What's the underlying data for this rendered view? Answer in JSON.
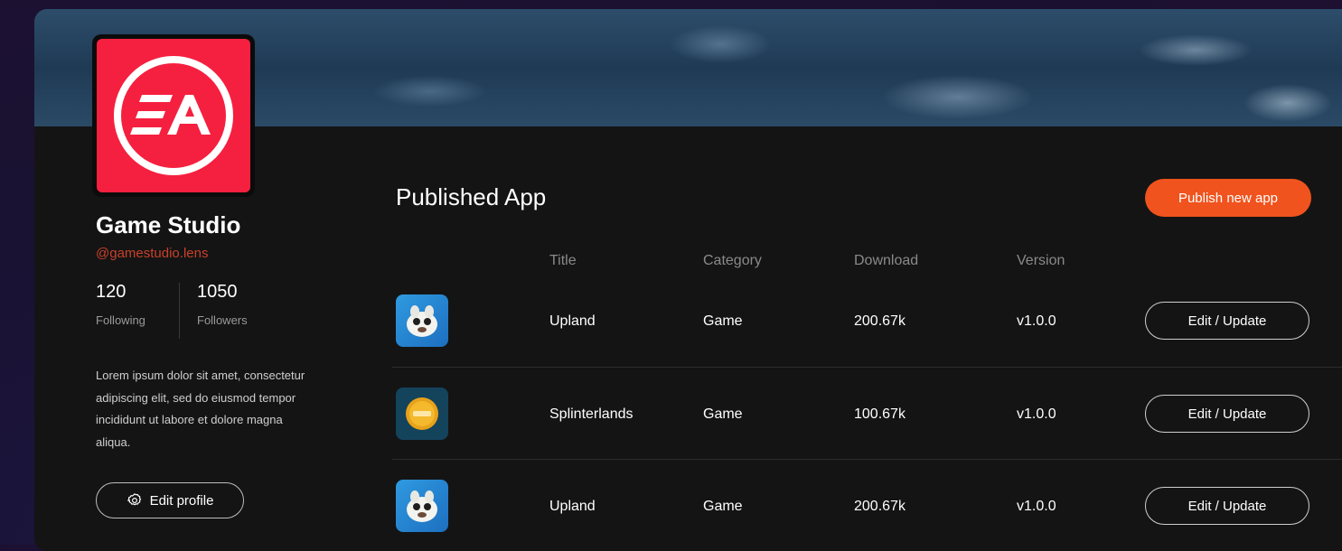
{
  "profile": {
    "logo_text": "EA",
    "name": "Game Studio",
    "handle": "@gamestudio.lens",
    "following_count": "120",
    "following_label": "Following",
    "followers_count": "1050",
    "followers_label": "Followers",
    "bio": "Lorem ipsum dolor sit amet, consectetur adipiscing elit, sed do eiusmod tempor incididunt ut labore et dolore magna aliqua.",
    "edit_label": "Edit profile"
  },
  "main": {
    "title": "Published App",
    "publish_label": "Publish new app",
    "columns": [
      "Title",
      "Category",
      "Download",
      "Version"
    ],
    "rows": [
      {
        "icon": "upland-app-icon",
        "title": "Upland",
        "category": "Game",
        "download": "200.67k",
        "version": "v1.0.0",
        "action": "Edit / Update"
      },
      {
        "icon": "splinterlands-app-icon",
        "title": "Splinterlands",
        "category": "Game",
        "download": "100.67k",
        "version": "v1.0.0",
        "action": "Edit / Update"
      },
      {
        "icon": "upland-app-icon",
        "title": "Upland",
        "category": "Game",
        "download": "200.67k",
        "version": "v1.0.0",
        "action": "Edit / Update"
      }
    ]
  },
  "colors": {
    "accent": "#f0531d",
    "logo_bg": "#f5203f",
    "handle": "#c8412a"
  }
}
